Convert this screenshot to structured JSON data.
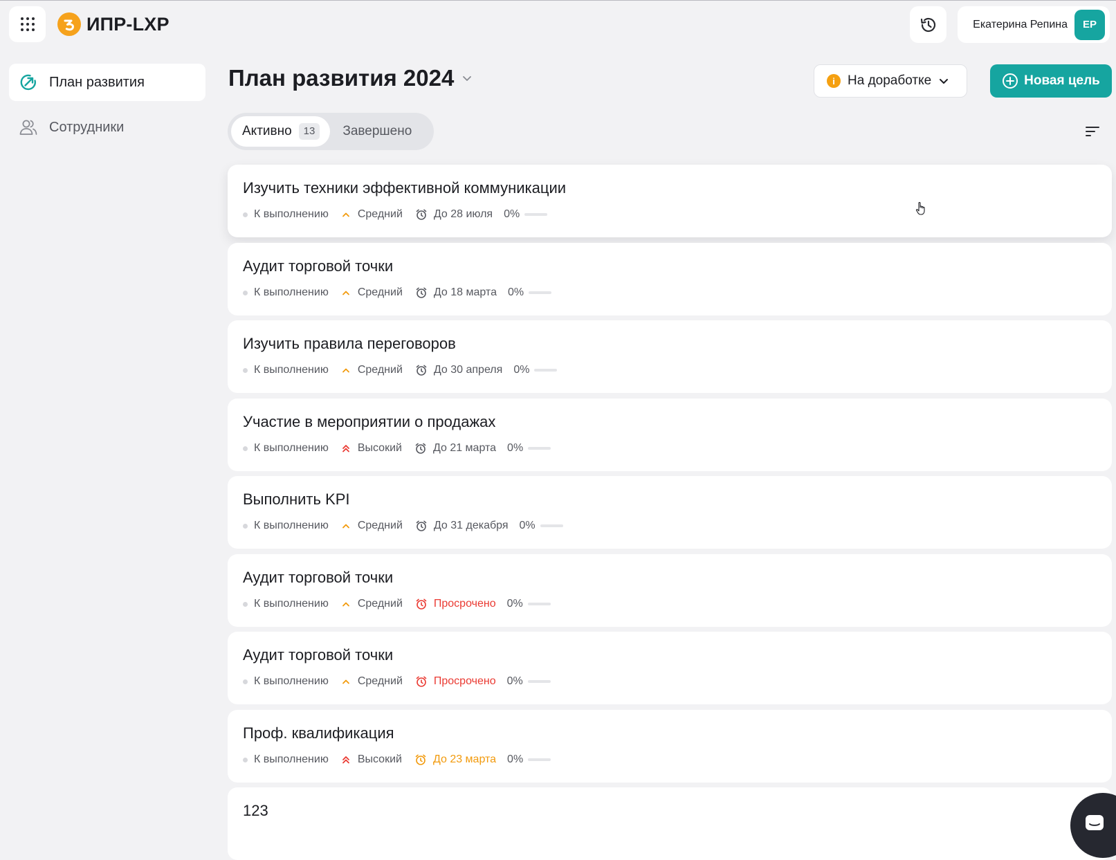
{
  "header": {
    "logo_text": "ИПР-LXP",
    "user_name": "Екатерина Репина",
    "user_initials": "ЕР"
  },
  "sidebar": {
    "items": [
      {
        "label": "План развития",
        "icon": "target-arrow-icon",
        "active": true
      },
      {
        "label": "Сотрудники",
        "icon": "users-icon",
        "active": false
      }
    ]
  },
  "main": {
    "title": "План развития 2024",
    "status_filter": "На доработке",
    "new_goal_label": "Новая цель",
    "tabs": [
      {
        "label": "Активно",
        "count": "13"
      },
      {
        "label": "Завершено"
      }
    ]
  },
  "goals": [
    {
      "title": "Изучить техники эффективной коммуникации",
      "status": "К выполнению",
      "priority": "Средний",
      "priority_level": "medium",
      "deadline": "До 28 июля",
      "deadline_state": "normal",
      "progress": "0%"
    },
    {
      "title": "Аудит торговой точки",
      "status": "К выполнению",
      "priority": "Средний",
      "priority_level": "medium",
      "deadline": "До 18 марта",
      "deadline_state": "normal",
      "progress": "0%"
    },
    {
      "title": "Изучить правила переговоров",
      "status": "К выполнению",
      "priority": "Средний",
      "priority_level": "medium",
      "deadline": "До 30 апреля",
      "deadline_state": "normal",
      "progress": "0%"
    },
    {
      "title": "Участие в мероприятии о продажах",
      "status": "К выполнению",
      "priority": "Высокий",
      "priority_level": "high",
      "deadline": "До 21 марта",
      "deadline_state": "normal",
      "progress": "0%"
    },
    {
      "title": "Выполнить KPI",
      "status": "К выполнению",
      "priority": "Средний",
      "priority_level": "medium",
      "deadline": "До 31 декабря",
      "deadline_state": "normal",
      "progress": "0%"
    },
    {
      "title": "Аудит торговой точки",
      "status": "К выполнению",
      "priority": "Средний",
      "priority_level": "medium",
      "deadline": "Просрочено",
      "deadline_state": "overdue",
      "progress": "0%"
    },
    {
      "title": "Аудит торговой точки",
      "status": "К выполнению",
      "priority": "Средний",
      "priority_level": "medium",
      "deadline": "Просрочено",
      "deadline_state": "overdue",
      "progress": "0%"
    },
    {
      "title": "Проф. квалификация",
      "status": "К выполнению",
      "priority": "Высокий",
      "priority_level": "high",
      "deadline": "До 23 марта",
      "deadline_state": "soon",
      "progress": "0%"
    },
    {
      "title": "123"
    }
  ],
  "colors": {
    "accent": "#16a5a0",
    "warning": "#f5a011",
    "overdue": "#ea3a32",
    "priority_medium": "#f29a0c",
    "priority_high": "#ea3a32",
    "background": "#f2f2f4"
  }
}
